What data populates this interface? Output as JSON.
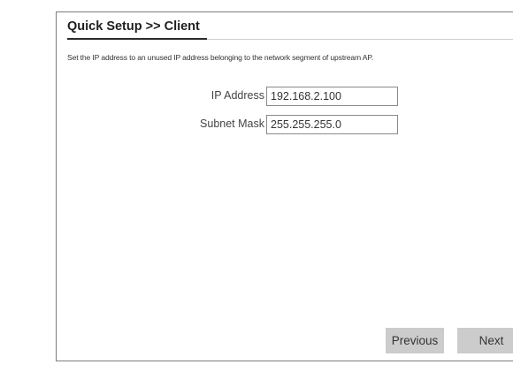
{
  "header": {
    "title": "Quick Setup >> Client"
  },
  "main": {
    "description": "Set the IP address to an unused IP address belonging to the network segment of upstream AP.",
    "fields": [
      {
        "label": "IP Address",
        "value": "192.168.2.100"
      },
      {
        "label": "Subnet Mask",
        "value": "255.255.255.0"
      }
    ]
  },
  "buttons": {
    "previous_label": "Previous",
    "next_label": "Next"
  },
  "colors": {
    "button_bg": "#cccccc",
    "border": "#7d7d7d"
  }
}
